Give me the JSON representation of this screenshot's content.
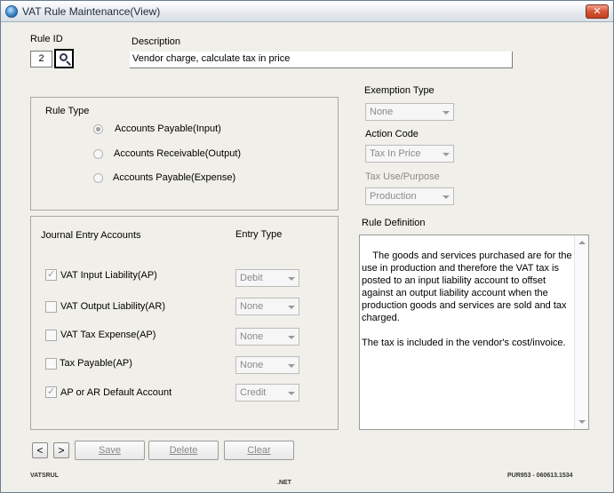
{
  "window": {
    "title": "VAT Rule Maintenance(View)",
    "close_glyph": "✕"
  },
  "rule_id": {
    "label": "Rule ID",
    "value": "2"
  },
  "description": {
    "label": "Description",
    "value": "Vendor charge, calculate tax in price"
  },
  "rule_type": {
    "label": "Rule Type",
    "options": [
      {
        "label": "Accounts Payable(Input)",
        "checked": true
      },
      {
        "label": "Accounts Receivable(Output)",
        "checked": false
      },
      {
        "label": "Accounts Payable(Expense)",
        "checked": false
      }
    ]
  },
  "exemption_type": {
    "label": "Exemption Type",
    "value": "None"
  },
  "action_code": {
    "label": "Action Code",
    "value": "Tax In Price"
  },
  "tax_use": {
    "label": "Tax Use/Purpose",
    "value": "Production"
  },
  "journal": {
    "label": "Journal Entry Accounts",
    "entry_type_label": "Entry Type",
    "rows": [
      {
        "label": "VAT Input Liability(AP)",
        "checked": true,
        "entry": "Debit"
      },
      {
        "label": "VAT Output Liability(AR)",
        "checked": false,
        "entry": "None"
      },
      {
        "label": "VAT Tax Expense(AP)",
        "checked": false,
        "entry": "None"
      },
      {
        "label": "Tax Payable(AP)",
        "checked": false,
        "entry": "None"
      },
      {
        "label": "AP or AR Default Account",
        "checked": true,
        "entry": "Credit"
      }
    ]
  },
  "rule_definition": {
    "label": "Rule Definition",
    "text": "The goods and services purchased are for the use in production and therefore the VAT tax is posted to an input liability account to offset against an output liability account when the production goods and services are sold and tax charged.\n\nThe tax is included in the vendor's cost/invoice."
  },
  "buttons": {
    "prev": "<",
    "next": ">",
    "save": "Save",
    "delete": "Delete",
    "clear": "Clear"
  },
  "footer": {
    "left": "VATSRUL",
    "center": ".NET",
    "right": "PUR953 - 060613.1534"
  },
  "icons": {
    "app": "globe-icon",
    "lookup": "magnifier-icon"
  }
}
